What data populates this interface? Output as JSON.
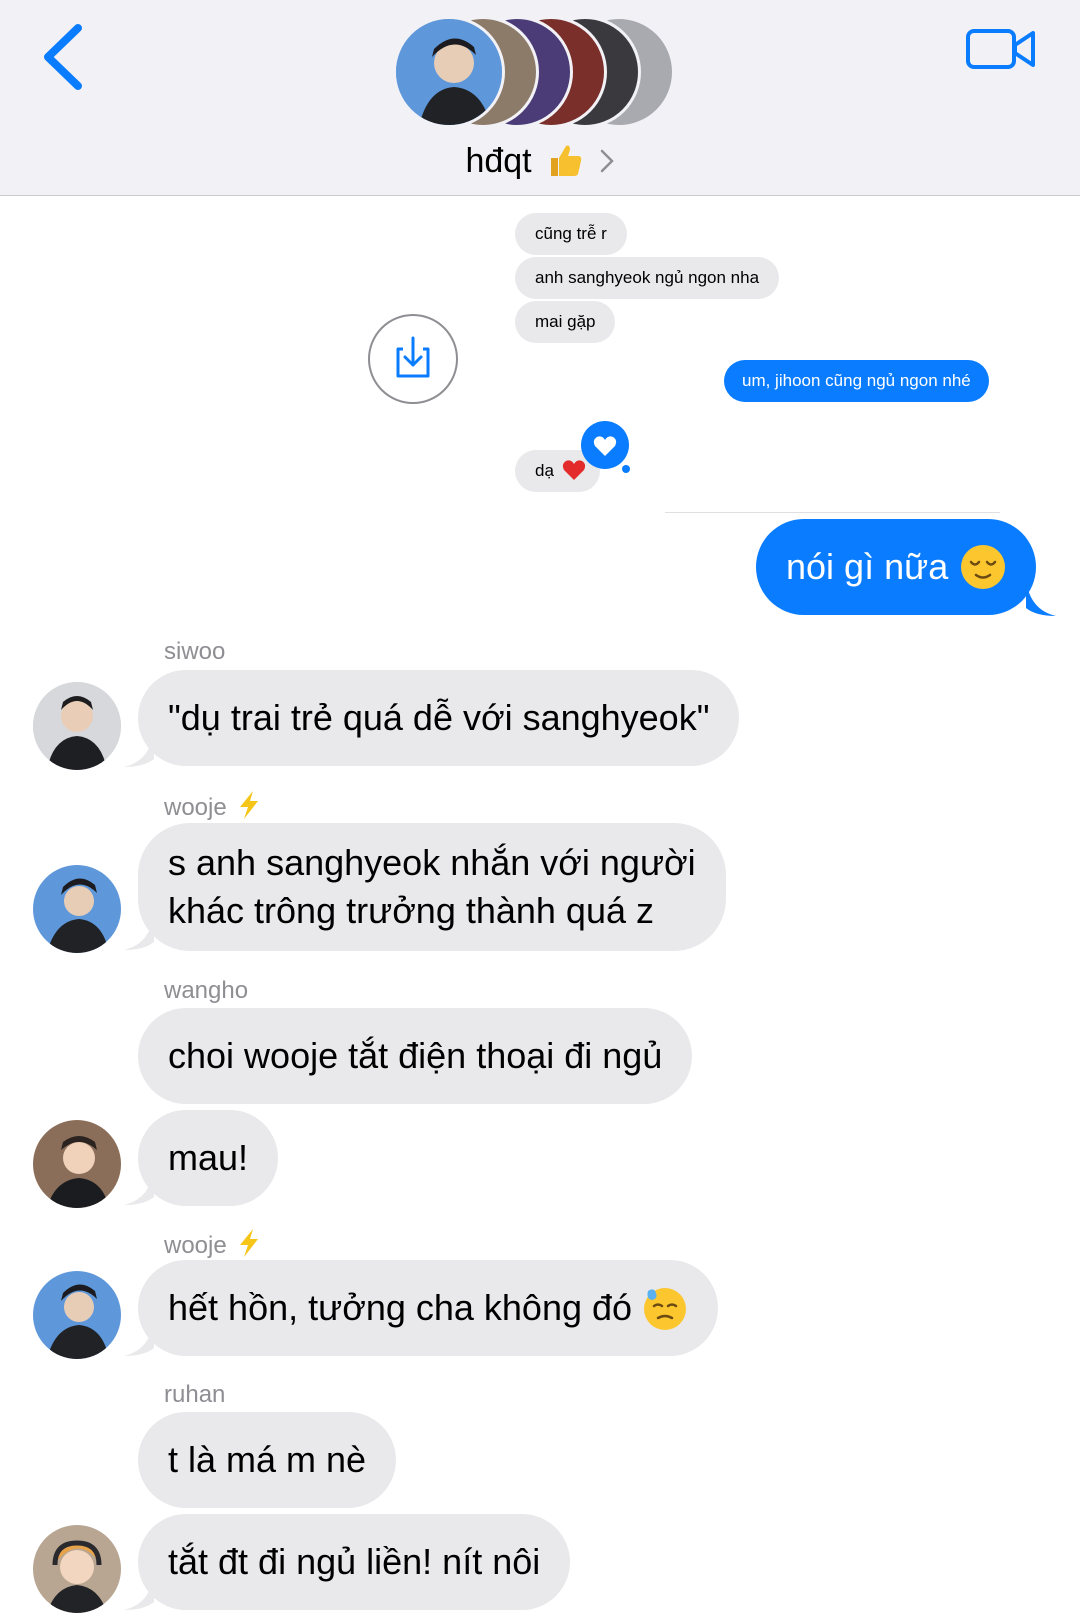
{
  "header": {
    "title": "hđqt",
    "title_emoji_icon": "thumbs-up-icon",
    "back_icon": "chevron-left-icon",
    "video_icon": "video-camera-icon",
    "accent": "#0a7cff"
  },
  "collage": {
    "messages_in": [
      "cũng trễ r",
      "anh sanghyeok ngủ ngon nha",
      "mai gặp"
    ],
    "message_out": "um, jihoon cũng ngủ ngon nhé",
    "reply": "dạ",
    "reaction_icon": "heart-icon",
    "share_icon": "share-download-icon"
  },
  "messages": [
    {
      "type": "out",
      "text": "nói gì nữa",
      "emoji": "relieved-face-icon"
    },
    {
      "type": "in",
      "sender": "siwoo",
      "text": "\"dụ trai trẻ quá dễ với sanghyeok\""
    },
    {
      "type": "in",
      "sender": "wooje",
      "sender_icon": "lightning-icon",
      "lines": [
        "s anh sanghyeok nhắn với người",
        "khác trông trưởng thành quá z"
      ]
    },
    {
      "type": "in",
      "sender": "wangho",
      "text": "choi wooje tắt điện thoại đi ngủ"
    },
    {
      "type": "in",
      "text": "mau!"
    },
    {
      "type": "in",
      "sender": "wooje",
      "sender_icon": "lightning-icon",
      "text": "hết hồn, tưởng cha không đó",
      "emoji": "sweat-face-icon"
    },
    {
      "type": "in",
      "sender": "ruhan",
      "text": "t là má m nè"
    },
    {
      "type": "in",
      "text": "tắt đt đi ngủ liền! nít nôi"
    }
  ],
  "colors": {
    "bubble_in": "#e9e9eb",
    "bubble_out": "#0a7cff",
    "header_bg": "#f2f2f6",
    "sender_text": "#8e8e93",
    "bolt": "#f5c518"
  }
}
